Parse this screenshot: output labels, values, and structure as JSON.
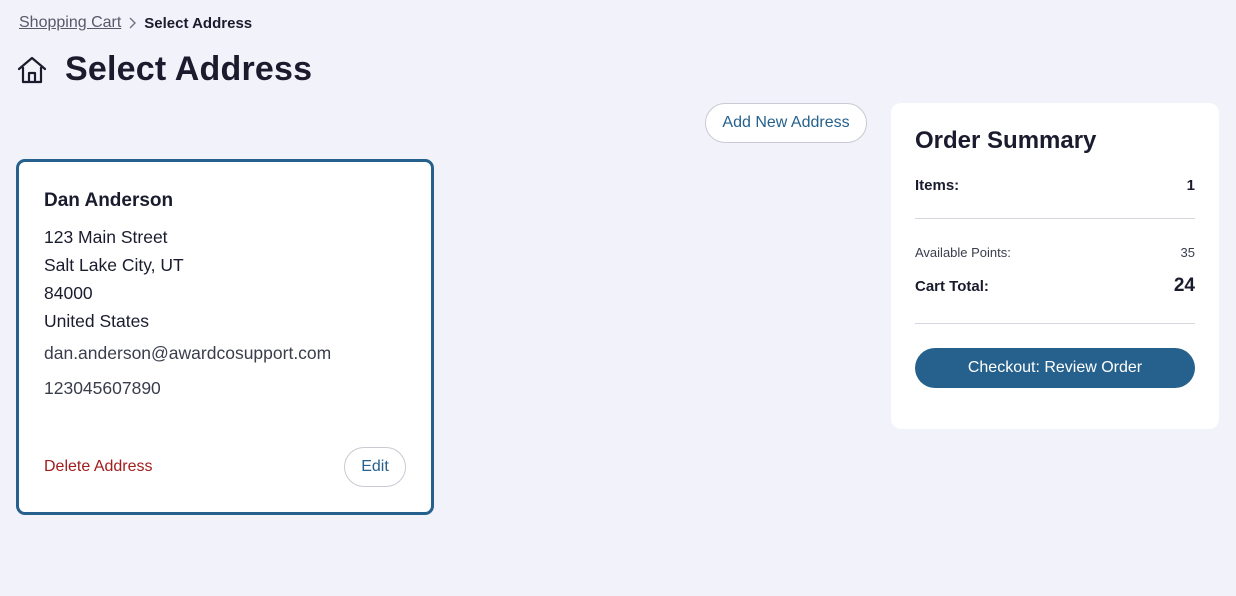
{
  "breadcrumb": {
    "parent": "Shopping Cart",
    "separator_icon": "chevron-right-icon",
    "current": "Select Address"
  },
  "page": {
    "title": "Select Address",
    "title_icon": "home-icon"
  },
  "actions": {
    "add_new_address": "Add New Address"
  },
  "address": {
    "name": "Dan Anderson",
    "street": "123 Main Street",
    "city_state": "Salt Lake City, UT",
    "zip": "84000",
    "country": "United States",
    "email": "dan.anderson@awardcosupport.com",
    "phone": "123045607890",
    "delete_label": "Delete Address",
    "edit_label": "Edit",
    "selected": true
  },
  "summary": {
    "title": "Order Summary",
    "items_label": "Items:",
    "items_value": "1",
    "points_label": "Available Points:",
    "points_value": "35",
    "total_label": "Cart Total:",
    "total_value": "24",
    "checkout_label": "Checkout: Review Order"
  },
  "colors": {
    "accent": "#25618c",
    "danger": "#a11d1d",
    "background": "#f2f2fa"
  }
}
